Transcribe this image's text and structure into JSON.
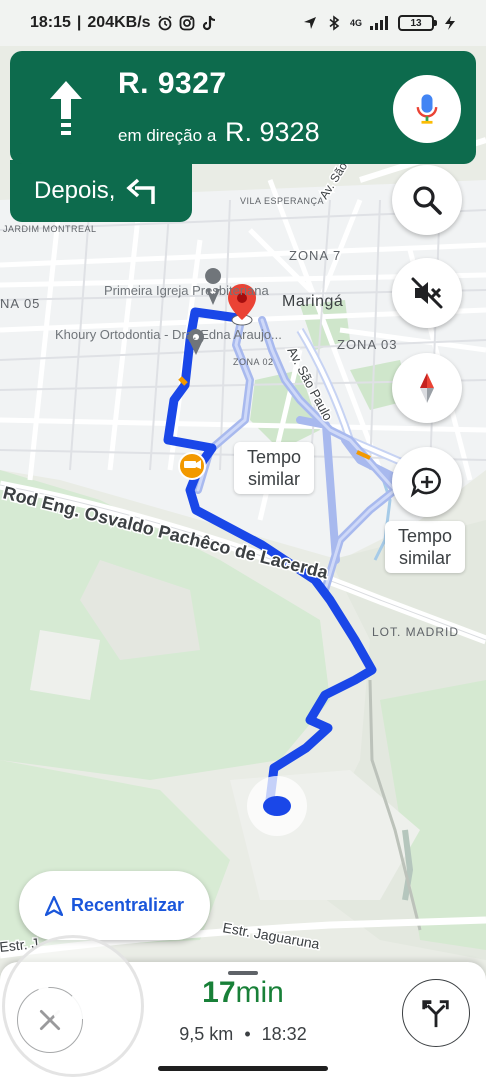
{
  "status_bar": {
    "time": "18:15",
    "data_speed": "204KB/s",
    "network": "4G",
    "battery": "13",
    "icons": [
      "alarm-icon",
      "instagram-icon",
      "tiktok-icon",
      "location-icon",
      "bluetooth-icon",
      "signal-icon",
      "battery-icon",
      "charging-icon"
    ]
  },
  "navigation": {
    "maneuver_icon": "straight-arrow-icon",
    "street": "R. 9327",
    "towards_label": "em direção a",
    "towards_street": "R. 9328",
    "then_label": "Depois,",
    "then_icon": "turn-left-icon",
    "mic_icon": "microphone-icon"
  },
  "map": {
    "labels": {
      "av_sao": "Av. São",
      "vila_esperanca": "VILA ESPERANÇA",
      "jardim_montreal": "JARDIM MONTREAL",
      "zona_7": "ZONA 7",
      "zona_05": "NA 05",
      "maringa": "Maringá",
      "zona_03": "ZONA 03",
      "zona_02": "ZONA 02",
      "av_sao_paulo": "Av. São Paulo",
      "lot_madrid": "LOT. MADRID",
      "rod_osvaldo": "Rod Eng. Osvaldo Pachêco de Lacerda",
      "estr_jaguaruna": "Estr. Jaguaruna",
      "estr_left": "Estr. J",
      "poi_church": "Primeira Igreja Presbiteriana",
      "poi_dentist": "Khoury Ortodontia - Dra. Edna Araujo..."
    },
    "tag_left": "Tempo similar",
    "tag_right": "Tempo similar",
    "route_color": "#1a47e8",
    "alt_route_color": "#a8b9ee"
  },
  "controls": {
    "search_icon": "search-icon",
    "mute_icon": "mute-icon",
    "compass_icon": "compass-icon",
    "report_icon": "add-report-icon",
    "recenter_label": "Recentralizar"
  },
  "trip": {
    "eta_minutes": "17",
    "eta_unit": "min",
    "distance": "9,5 km",
    "separator": "•",
    "arrival_time": "18:32"
  }
}
